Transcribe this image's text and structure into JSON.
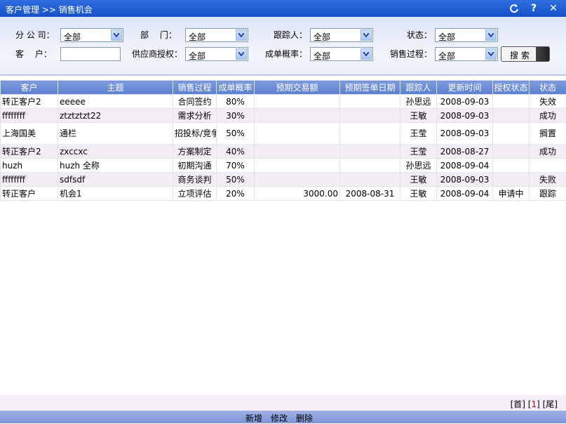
{
  "window": {
    "title": "客户管理 >> 销售机会",
    "icons": [
      "refresh-icon",
      "help-icon",
      "close-icon"
    ]
  },
  "filters": {
    "branch_label": "分 公 司：",
    "branch_value": "全部",
    "dept_label": "部　 门：",
    "dept_value": "全部",
    "tracker_label": "跟踪人：",
    "tracker_value": "全部",
    "status_label": "状态：",
    "status_value": "全部",
    "customer_label": "客　 户：",
    "customer_value": "",
    "supplier_auth_label": "供应商授权：",
    "supplier_auth_value": "全部",
    "probability_label": "成单概率：",
    "probability_value": "全部",
    "process_label": "销售过程：",
    "process_value": "全部",
    "search_button": "搜索"
  },
  "table": {
    "headers": [
      "客户",
      "主题",
      "销售过程",
      "成单概率",
      "预期交易额",
      "预期签单日期",
      "跟踪人",
      "更新时间",
      "授权状态",
      "状态"
    ],
    "rows": [
      {
        "customer": "转正客户2",
        "subject": "eeeee",
        "process": "合同签约",
        "prob": "80%",
        "amount": "",
        "sign_date": "",
        "tracker": "孙思远",
        "updated": "2008-09-03",
        "auth": "",
        "status": "失效"
      },
      {
        "customer": "ffffffff",
        "subject": "ztztztzt22",
        "process": "需求分析",
        "prob": "30%",
        "amount": "",
        "sign_date": "",
        "tracker": "王敏",
        "updated": "2008-09-03",
        "auth": "",
        "status": "成功"
      },
      {
        "customer": "上海国美",
        "subject": "通栏",
        "process": "招投标/竞争",
        "prob": "50%",
        "amount": "",
        "sign_date": "",
        "tracker": "王莹",
        "updated": "2008-09-03",
        "auth": "",
        "status": "搁置"
      },
      {
        "customer": "转正客户2",
        "subject": "zxccxc",
        "process": "方案制定",
        "prob": "40%",
        "amount": "",
        "sign_date": "",
        "tracker": "王莹",
        "updated": "2008-08-27",
        "auth": "",
        "status": "成功"
      },
      {
        "customer": "huzh",
        "subject": "huzh 全称",
        "process": "初期沟通",
        "prob": "70%",
        "amount": "",
        "sign_date": "",
        "tracker": "孙思远",
        "updated": "2008-09-04",
        "auth": "",
        "status": ""
      },
      {
        "customer": "ffffffff",
        "subject": "sdfsdf",
        "process": "商务谈判",
        "prob": "50%",
        "amount": "",
        "sign_date": "",
        "tracker": "王敏",
        "updated": "2008-09-03",
        "auth": "",
        "status": "失败"
      },
      {
        "customer": "转正客户",
        "subject": "机会1",
        "process": "立项评估",
        "prob": "20%",
        "amount": "3000.00",
        "sign_date": "2008-08-31",
        "tracker": "王敏",
        "updated": "2008-09-04",
        "auth": "申请中",
        "status": "跟踪"
      }
    ]
  },
  "pager": {
    "first": "[首]",
    "current_open": "[",
    "current": "1",
    "current_close": "]",
    "last": "[尾]"
  },
  "toolbar": {
    "add": "新增",
    "edit": "修改",
    "delete": "删除"
  }
}
